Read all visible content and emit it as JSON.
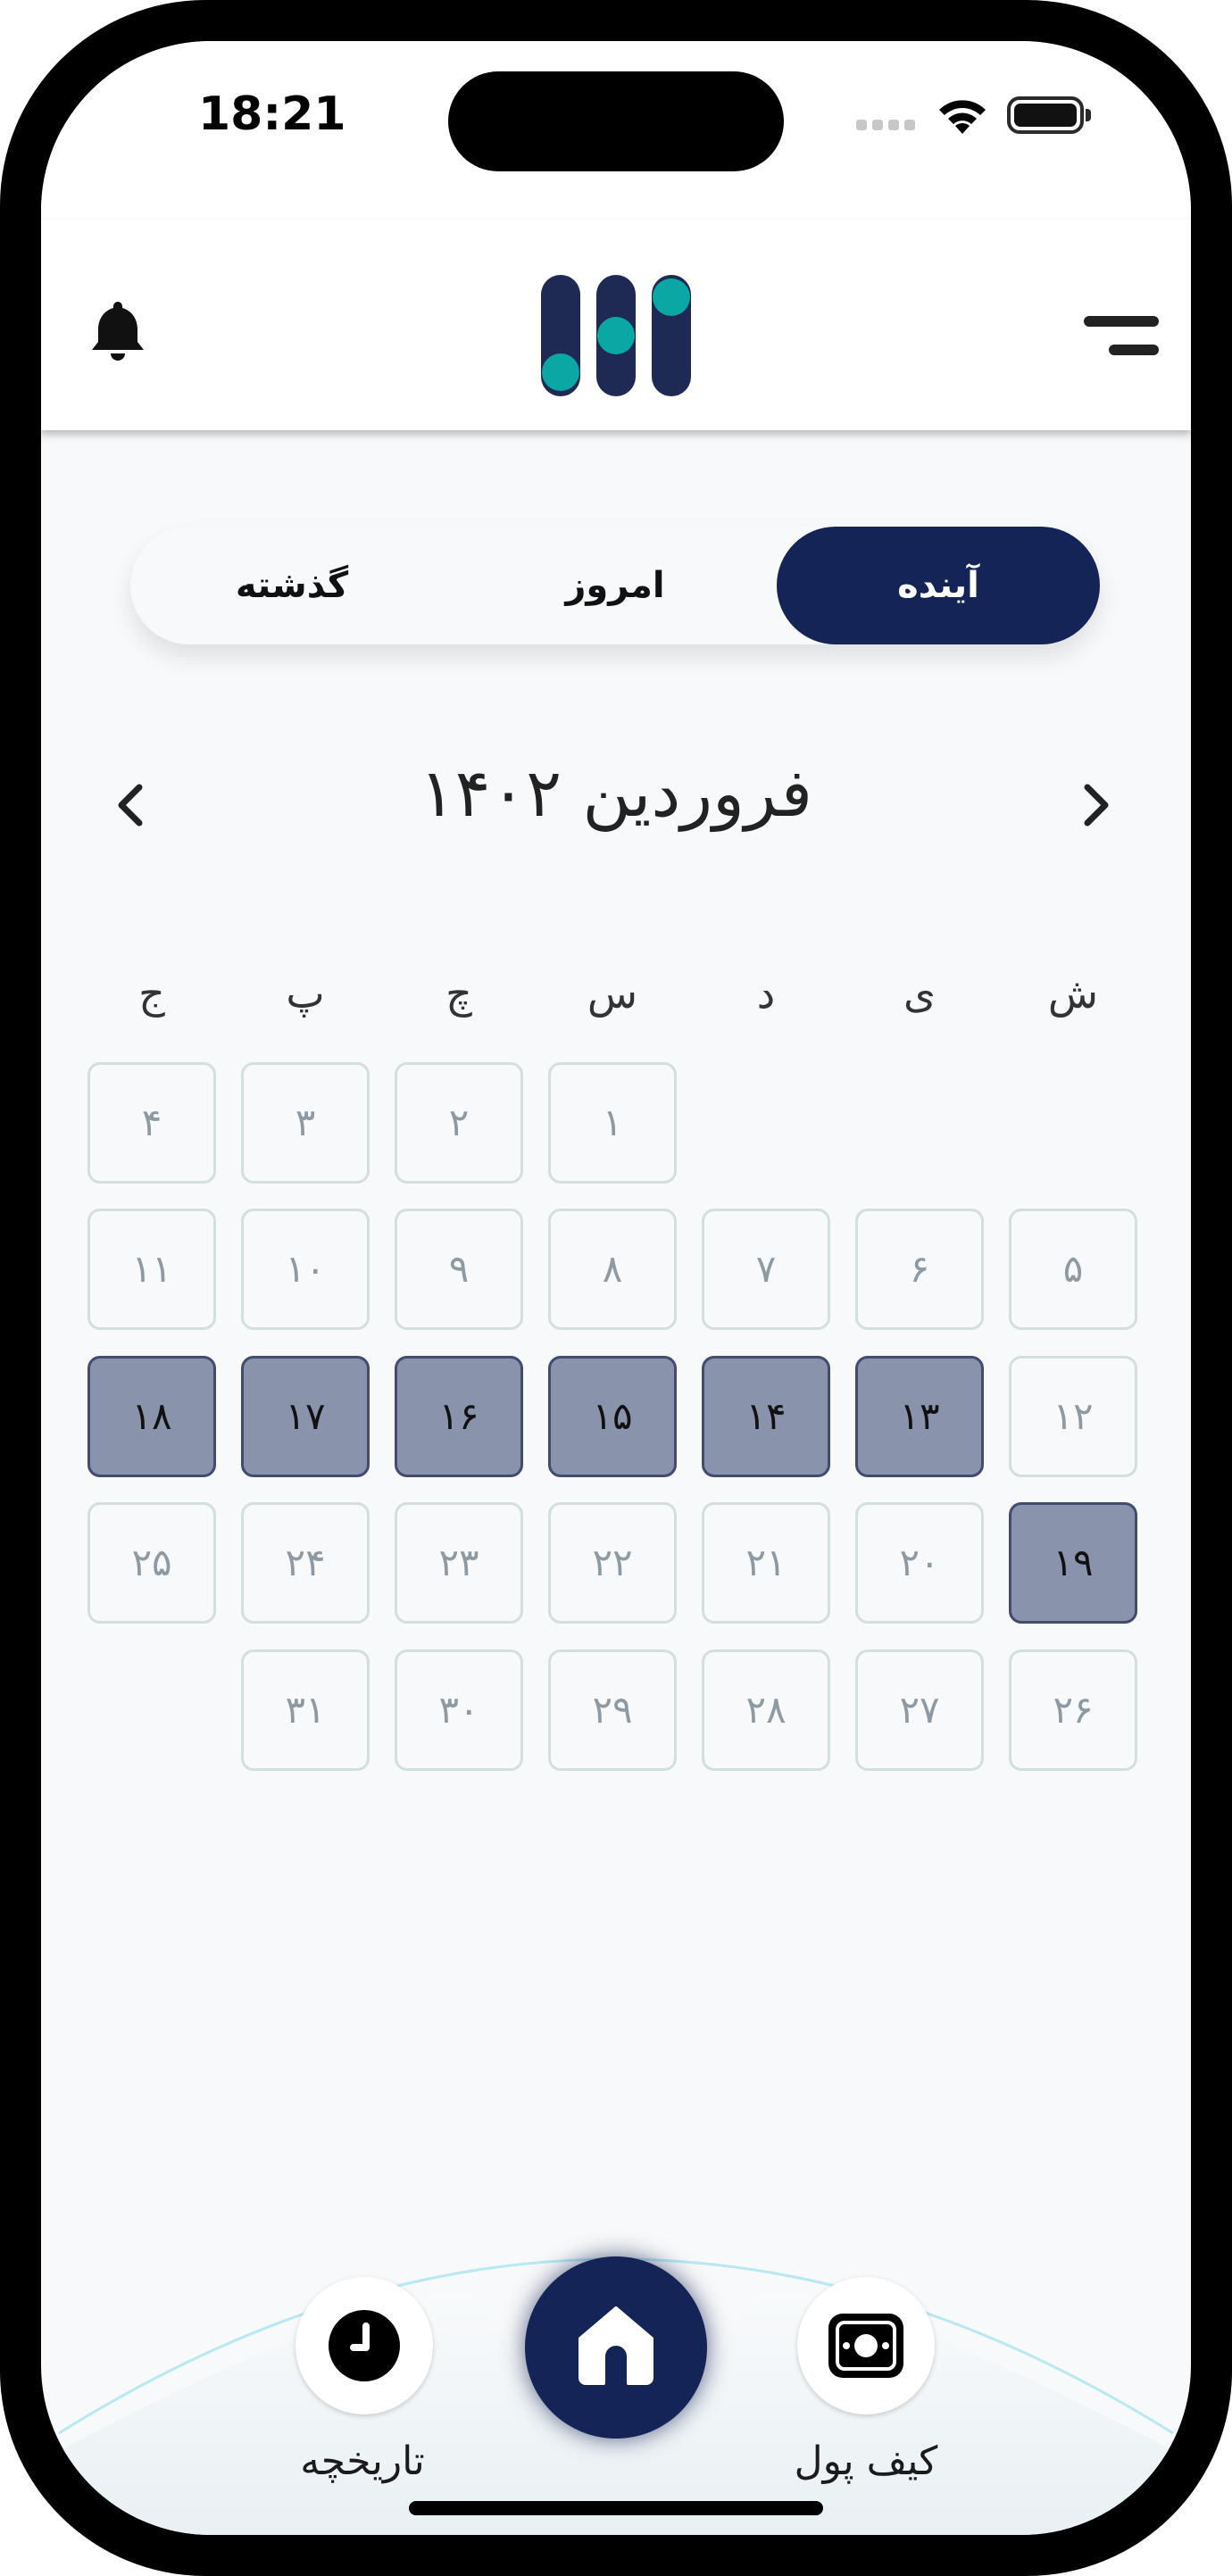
{
  "status": {
    "time": "18:21"
  },
  "tabs": {
    "past": "گذشته",
    "today": "امروز",
    "future": "آینده"
  },
  "calendar": {
    "month_title": "فروردین ۱۴۰۲",
    "weekdays": [
      "ش",
      "ی",
      "د",
      "س",
      "چ",
      "پ",
      "ج"
    ],
    "days": [
      "۱",
      "۲",
      "۳",
      "۴",
      "۵",
      "۶",
      "۷",
      "۸",
      "۹",
      "۱۰",
      "۱۱",
      "۱۲",
      "۱۳",
      "۱۴",
      "۱۵",
      "۱۶",
      "۱۷",
      "۱۸",
      "۱۹",
      "۲۰",
      "۲۱",
      "۲۲",
      "۲۳",
      "۲۴",
      "۲۵",
      "۲۶",
      "۲۷",
      "۲۸",
      "۲۹",
      "۳۰",
      "۳۱"
    ],
    "selected": [
      13,
      14,
      15,
      16,
      17,
      18,
      19
    ]
  },
  "bottom_nav": {
    "history_label": "تاریخچه",
    "wallet_label": "کیف پول"
  },
  "colors": {
    "primary": "#152456",
    "accent": "#0aa7a5",
    "selected_day": "#8993ab"
  },
  "icons": [
    "bell-icon",
    "menu-icon",
    "chevron-left-icon",
    "chevron-right-icon",
    "clock-icon",
    "home-icon",
    "wallet-icon"
  ]
}
